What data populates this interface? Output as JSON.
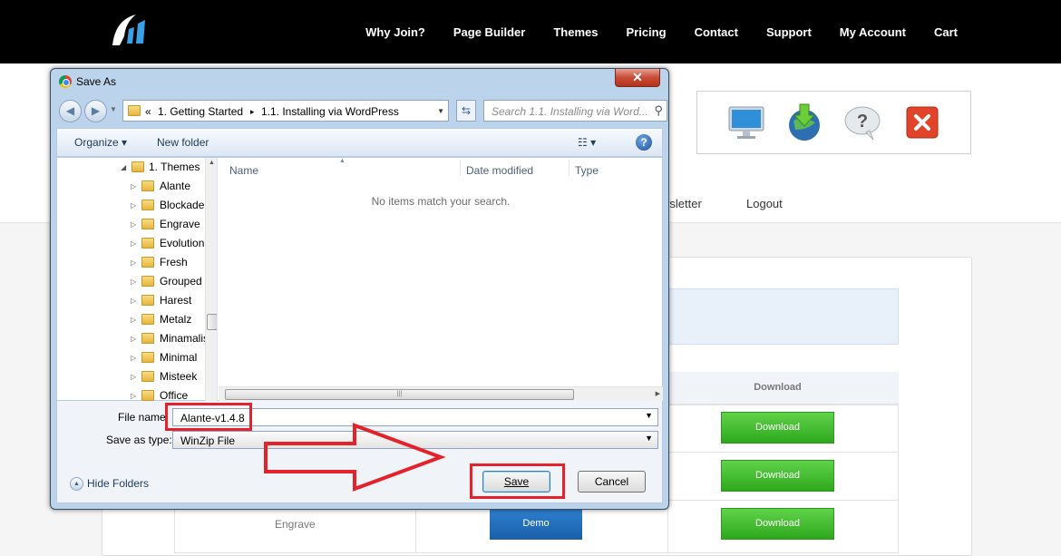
{
  "site": {
    "nav": [
      "Why Join?",
      "Page Builder",
      "Themes",
      "Pricing",
      "Contact",
      "Support",
      "My Account",
      "Cart"
    ],
    "subnav": {
      "newsletter": "wsletter",
      "logout": "Logout"
    },
    "table": {
      "download_header": "Download",
      "download_button": "Download",
      "demo_button": "Demo",
      "row_label": "Engrave"
    },
    "icons": [
      "monitor-icon",
      "download-globe-icon",
      "help-bubble-icon",
      "close-red-icon"
    ]
  },
  "dialog": {
    "title": "Save As",
    "close_label": "✕",
    "breadcrumb": {
      "overflow": "«",
      "part1": "1. Getting Started",
      "sep": "▸",
      "part2": "1.1. Installing via WordPress"
    },
    "search_placeholder": "Search 1.1. Installing via Word...",
    "toolbar": {
      "organize": "Organize ▾",
      "new_folder": "New folder",
      "view": "☷ ▾"
    },
    "tree": {
      "parent": "1. Themes",
      "items": [
        "Alante",
        "Blockade",
        "Engrave",
        "Evolution",
        "Fresh",
        "Grouped",
        "Harest",
        "Metalz",
        "Minamalist",
        "Minimal",
        "Misteek",
        "Office"
      ]
    },
    "columns": {
      "name": "Name",
      "date": "Date modified",
      "type": "Type"
    },
    "empty_message": "No items match your search.",
    "file_name_label": "File name:",
    "file_name_value": "Alante-v1.4.8",
    "save_type_label": "Save as type:",
    "save_type_value": "WinZip File",
    "hide_folders": "Hide Folders",
    "save_button": "Save",
    "cancel_button": "Cancel"
  },
  "colors": {
    "highlight": "#e3222c",
    "download_green": "#3cb82a",
    "demo_blue": "#1f6bbd"
  }
}
